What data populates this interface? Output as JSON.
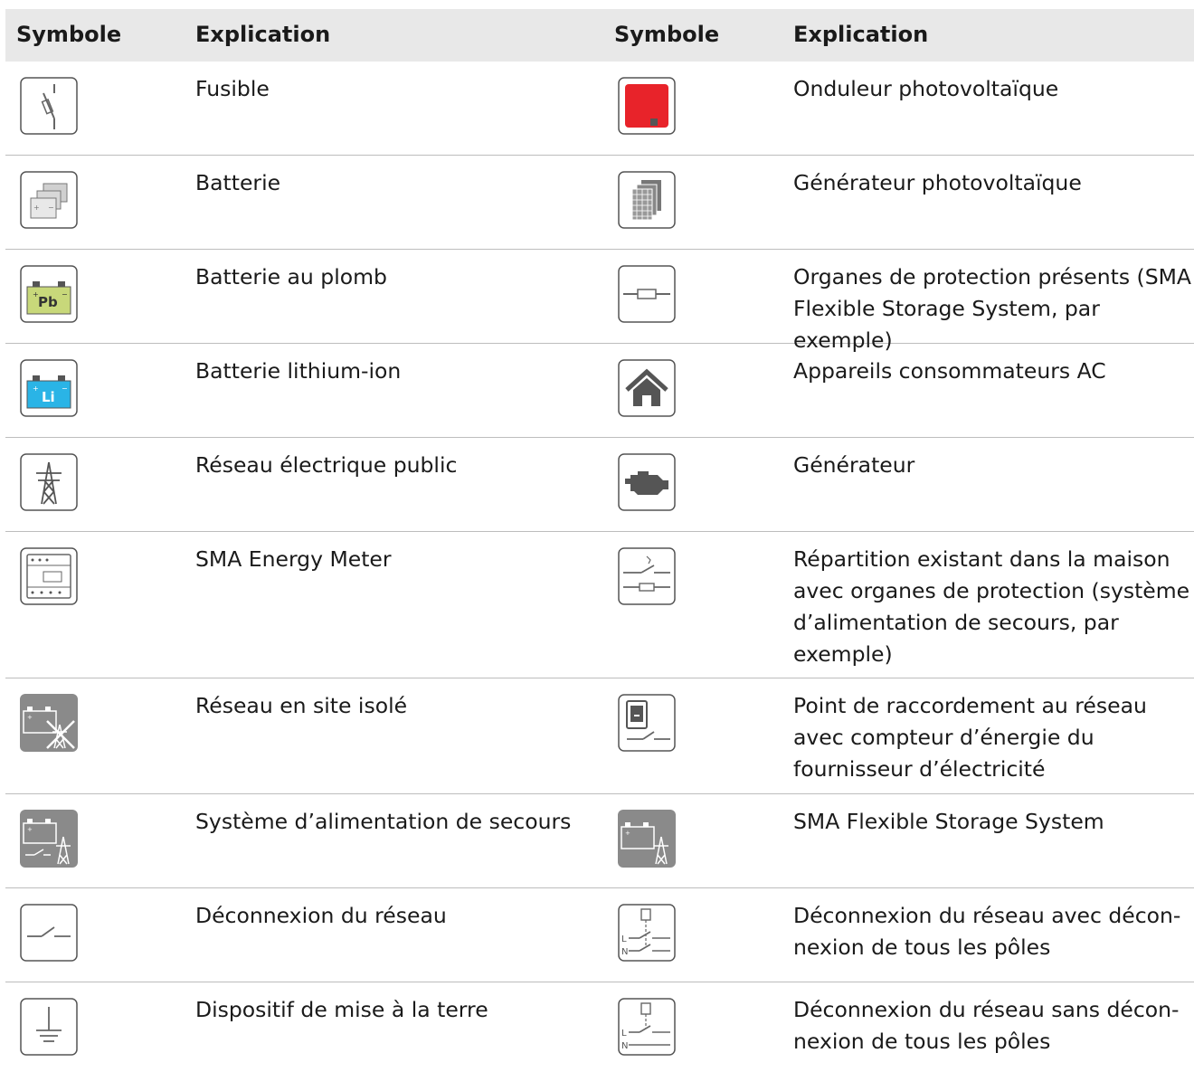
{
  "header": {
    "symbol_left": "Symbole",
    "explanation_left": "Explication",
    "symbol_right": "Symbole",
    "explanation_right": "Explication"
  },
  "rows": [
    {
      "left": {
        "icon": "fuse-icon",
        "text": "Fusible"
      },
      "right": {
        "icon": "pv-inverter-icon",
        "text": "Onduleur photovoltaïque"
      }
    },
    {
      "left": {
        "icon": "battery-icon",
        "text": "Batterie"
      },
      "right": {
        "icon": "pv-generator-icon",
        "text": "Générateur photovoltaïque"
      }
    },
    {
      "left": {
        "icon": "lead-battery-icon",
        "text": "Batterie au plomb"
      },
      "right": {
        "icon": "protective-devices-icon",
        "text": "Organes de protection présents (SMA Flexible Storage System, par exemple)"
      }
    },
    {
      "left": {
        "icon": "lithium-battery-icon",
        "text": "Batterie lithium-ion"
      },
      "right": {
        "icon": "ac-loads-house-icon",
        "text": "Appareils consommateurs AC"
      }
    },
    {
      "left": {
        "icon": "utility-grid-pylon-icon",
        "text": "Réseau électrique public"
      },
      "right": {
        "icon": "generator-engine-icon",
        "text": "Générateur"
      }
    },
    {
      "left": {
        "icon": "energy-meter-icon",
        "text": "SMA Energy Meter"
      },
      "right": {
        "icon": "house-distribution-icon",
        "text": "Répartition existant dans la maison avec organes de protection (système d’alimentation de secours, par exemple)"
      }
    },
    {
      "left": {
        "icon": "off-grid-icon",
        "text": "Réseau en site isolé"
      },
      "right": {
        "icon": "grid-connection-point-meter-icon",
        "text": "Point de raccordement au réseau avec compteur d’énergie du fournisseur d’électricité"
      }
    },
    {
      "left": {
        "icon": "backup-system-icon",
        "text": "Système d’alimentation de secours"
      },
      "right": {
        "icon": "flexible-storage-icon",
        "text": "SMA Flexible Storage System"
      }
    },
    {
      "left": {
        "icon": "grid-disconnect-icon",
        "text": "Déconnexion du réseau"
      },
      "right": {
        "icon": "all-pole-disconnect-icon",
        "text": "Déconnexion du réseau avec décon-nexion de tous les pôles"
      }
    },
    {
      "left": {
        "icon": "grounding-icon",
        "text": "Dispositif de mise à la terre"
      },
      "right": {
        "icon": "single-pole-disconnect-icon",
        "text": "Déconnexion du réseau sans décon-nexion de tous les pôles"
      }
    }
  ],
  "colors": {
    "header_bg": "#e8e8e8",
    "icon_border": "#555555",
    "icon_gray": "#8a8a8a",
    "inverter_red": "#e8232a",
    "lead_green": "#c8d87a",
    "lithium_blue": "#2ab4e6",
    "row_divider": "#bdbdbd"
  }
}
